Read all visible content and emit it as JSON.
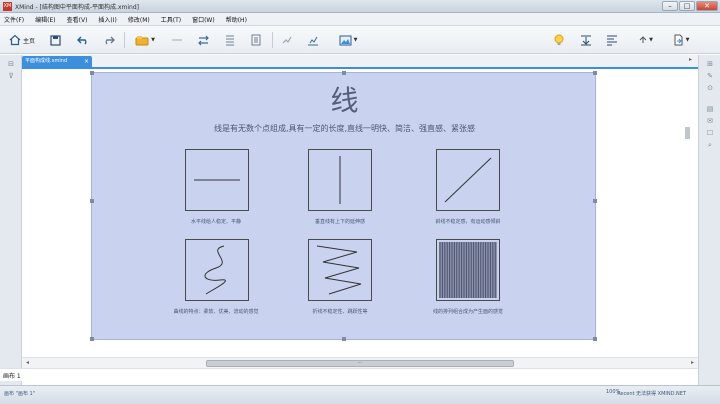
{
  "window": {
    "app_icon_text": "XM",
    "title": "XMind - [结构图中平面构成-平面构成.xmind]"
  },
  "menubar": {
    "items": [
      "文件(F)",
      "编辑(E)",
      "查看(V)",
      "插入(I)",
      "修改(M)",
      "工具(T)",
      "窗口(W)",
      "帮助(H)"
    ]
  },
  "toolbar": {
    "home_label": "主页"
  },
  "tab": {
    "label": "平面构成线.xmind"
  },
  "sheet": {
    "title": "线",
    "subtitle": "线是有无数个点组成,具有一定的长度,直线一明快、简洁、强直感、紧张感",
    "captions": [
      "水平线给人稳定、平静",
      "垂直线有上下的延伸感",
      "斜线不稳定感，有运动感倾斜",
      "曲线的特点：柔软、优美、流动的感觉",
      "折线不稳定性、跳跃性等",
      "线的排列组合成为产生面的感觉"
    ]
  },
  "bottom": {
    "sheet_tab": "画布 1",
    "status_left": "画布 \"画布 1\"",
    "status_zoom": "100%",
    "status_right": "Recent 无法获得 XMIND.NET"
  },
  "colors": {
    "accent": "#3b8fdc",
    "selection": "#c9d3ef"
  }
}
